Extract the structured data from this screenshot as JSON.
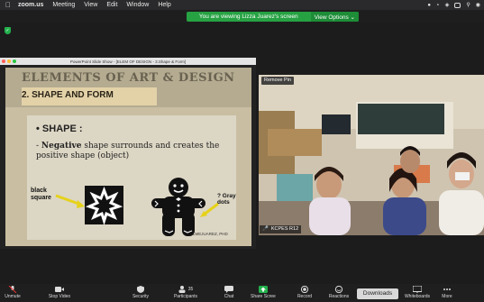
{
  "menubar": {
    "app": "zoom.us",
    "items": [
      "Meeting",
      "View",
      "Edit",
      "Window",
      "Help"
    ]
  },
  "zoom_top": {
    "viewing_text": "You are viewing Lizza Juarez's screen",
    "view_options": "View Options ⌄"
  },
  "ppt": {
    "window_title": "PowerPoint Slide Show - [ELEM OF DESIGN - 3.Shape & Form]",
    "slide_title": "ELEMENTS OF ART & DESIGN",
    "slide_subtitle": "2.  SHAPE AND FORM",
    "shape_heading": "• SHAPE :",
    "negative_word": "Negative",
    "negative_text": " shape surrounds and creates the positive shape (object)",
    "negative_prefix": "- ",
    "black_square_label": "black square",
    "gray_dots_label": "? Gray dots",
    "credit": "LMEJUAREZ, PHD"
  },
  "video": {
    "remove_pin": "Remove Pin",
    "participant": "KCPES R12"
  },
  "toolbar": {
    "items": [
      "Unmute",
      "Stop Video",
      "Security",
      "Participants",
      "Chat",
      "Share Screen",
      "Record",
      "Reactions",
      "Whiteboards",
      "More"
    ],
    "participants_count": "35",
    "downloads_label": "Downloads"
  },
  "colors": {
    "accent_green": "#26a243",
    "share_green": "#23b14d"
  }
}
